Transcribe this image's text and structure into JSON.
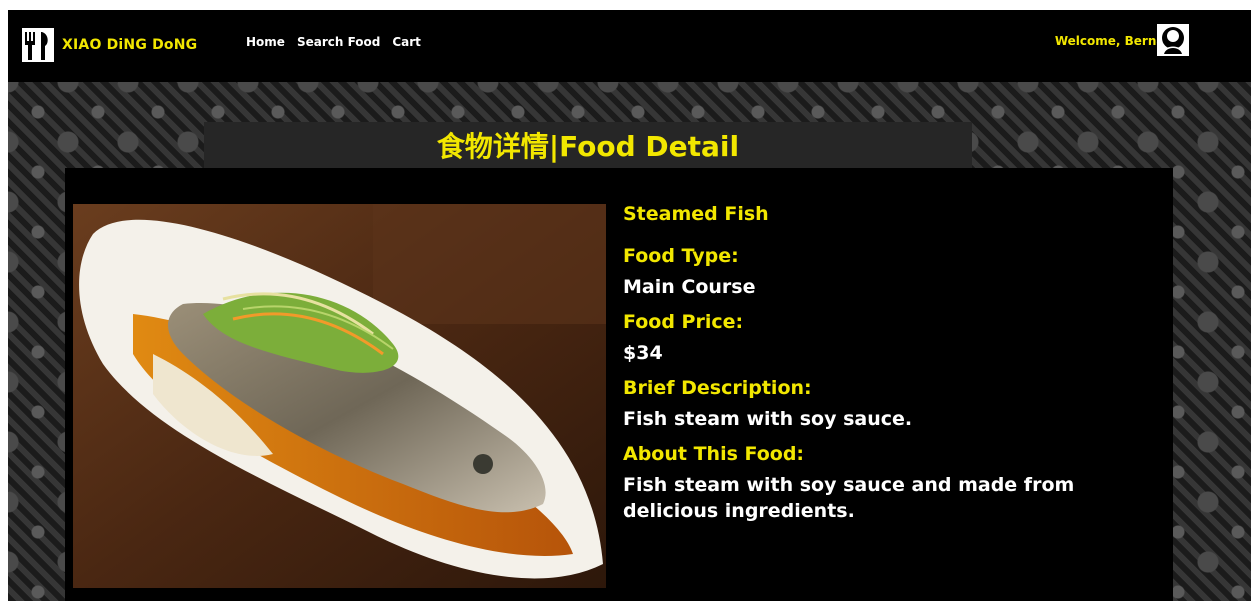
{
  "navbar": {
    "brand": "XIAO DiNG DoNG",
    "links": {
      "home": "Home",
      "search": "Search Food",
      "cart": "Cart"
    },
    "welcome": "Welcome, Bernard",
    "icons": {
      "logo": "fork-knife-icon",
      "avatar": "user-avatar-icon"
    }
  },
  "page": {
    "title": "食物详情|Food Detail"
  },
  "food": {
    "name": "Steamed Fish",
    "image_icon": "steamed-fish-photo",
    "type_label": "Food Type:",
    "type_value": "Main Course",
    "price_label": "Food Price:",
    "price_value": "$34",
    "brief_label": "Brief Description:",
    "brief_value": "Fish steam with soy sauce.",
    "about_label": "About This Food:",
    "about_value": "Fish steam with soy sauce and made from delicious ingredients."
  },
  "colors": {
    "accent_yellow": "#f2e700",
    "background": "#000000",
    "title_bar": "#262626",
    "text_white": "#ffffff"
  }
}
